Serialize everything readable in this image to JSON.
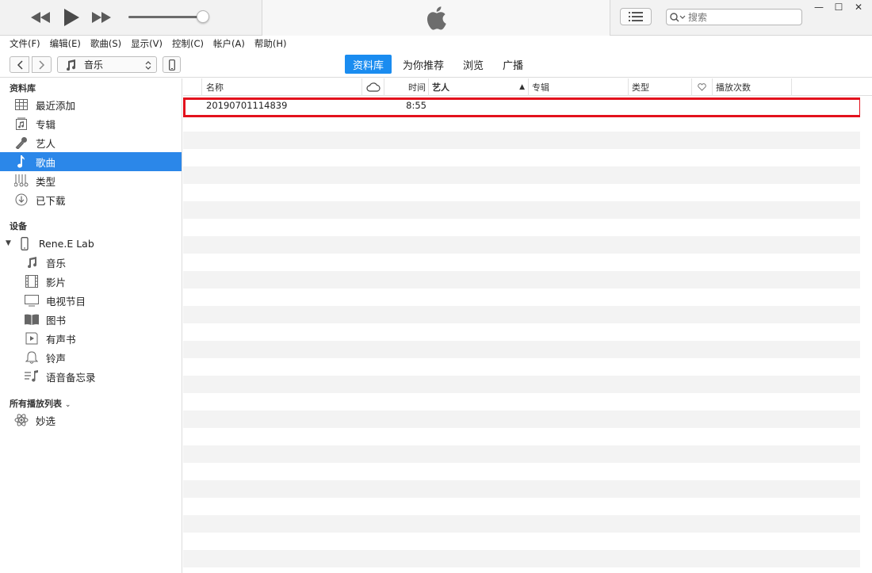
{
  "menu": [
    "文件(F)",
    "编辑(E)",
    "歌曲(S)",
    "显示(V)",
    "控制(C)",
    "帐户(A)",
    "帮助(H)"
  ],
  "search": {
    "placeholder": "搜索"
  },
  "window_controls": {
    "minimize": "—",
    "maximize": "☐",
    "close": "✕"
  },
  "nav": {
    "media_select": "音乐",
    "tabs": [
      {
        "label": "资料库",
        "active": true
      },
      {
        "label": "为你推荐",
        "active": false
      },
      {
        "label": "浏览",
        "active": false
      },
      {
        "label": "广播",
        "active": false
      }
    ]
  },
  "sidebar": {
    "library_header": "资料库",
    "library_items": [
      {
        "label": "最近添加",
        "icon": "grid-icon"
      },
      {
        "label": "专辑",
        "icon": "album-icon"
      },
      {
        "label": "艺人",
        "icon": "microphone-icon"
      },
      {
        "label": "歌曲",
        "icon": "music-note-icon",
        "selected": true
      },
      {
        "label": "类型",
        "icon": "genre-icon"
      },
      {
        "label": "已下载",
        "icon": "download-icon"
      }
    ],
    "devices_header": "设备",
    "device_name": "Rene.E Lab",
    "device_items": [
      {
        "label": "音乐",
        "icon": "music-note-icon"
      },
      {
        "label": "影片",
        "icon": "film-icon"
      },
      {
        "label": "电视节目",
        "icon": "tv-icon"
      },
      {
        "label": "图书",
        "icon": "book-icon"
      },
      {
        "label": "有声书",
        "icon": "audiobook-icon"
      },
      {
        "label": "铃声",
        "icon": "bell-icon"
      },
      {
        "label": "语音备忘录",
        "icon": "voice-memo-icon"
      }
    ],
    "playlists_header": "所有播放列表",
    "playlist_items": [
      {
        "label": "妙选",
        "icon": "genius-icon"
      }
    ]
  },
  "table": {
    "columns": {
      "name": "名称",
      "time": "时间",
      "artist": "艺人",
      "album": "专辑",
      "genre": "类型",
      "plays": "播放次数"
    },
    "rows": [
      {
        "name": "20190701114839",
        "time": "8:55"
      }
    ]
  },
  "colors": {
    "accent": "#1a8cf0",
    "selection": "#2b87e9",
    "highlight_box": "#e3121d"
  }
}
